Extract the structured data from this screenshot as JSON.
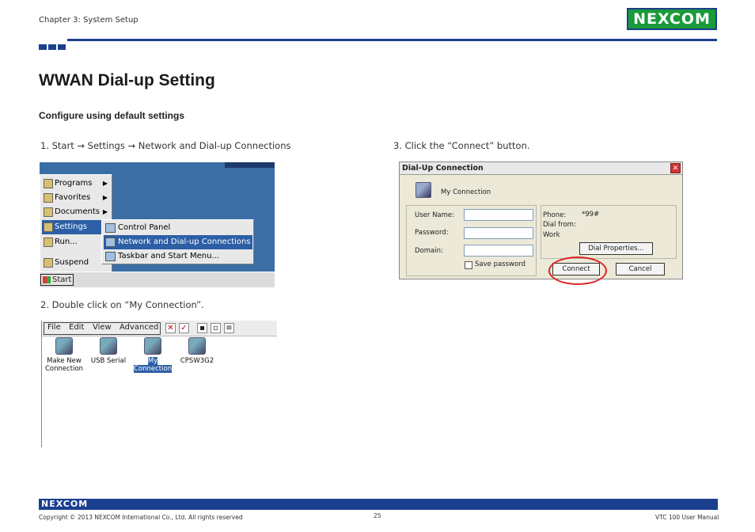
{
  "header": {
    "chapter": "Chapter 3: System Setup",
    "logo": "NEXCOM"
  },
  "title": "WWAN Dial-up Setting",
  "subtitle": "Configure using default settings",
  "steps": [
    "1. Start → Settings → Network and Dial-up Connections",
    "2. Double click on “My Connection”.",
    "3. Click the “Connect” button."
  ],
  "start_menu": {
    "items": [
      "Programs",
      "Favorites",
      "Documents",
      "Settings",
      "Run...",
      "Suspend"
    ],
    "submenu": [
      "Control Panel",
      "Network and Dial-up Connections",
      "Taskbar and Start Menu..."
    ],
    "start_label": "Start"
  },
  "explorer": {
    "menu": [
      "File",
      "Edit",
      "View",
      "Advanced"
    ],
    "icons": [
      "Make New Connection",
      "USB Serial",
      "My Connection",
      "CPSW3G2"
    ]
  },
  "dialog": {
    "title": "Dial-Up Connection",
    "connection_name": "My Connection",
    "labels": {
      "user_name": "User Name:",
      "password": "Password:",
      "domain": "Domain:",
      "save_password": "Save password"
    },
    "info": {
      "phone_label": "Phone:",
      "phone_value": "*99#",
      "dial_from_label": "Dial from:",
      "dial_from_value": "Work"
    },
    "buttons": {
      "dial_properties": "Dial Properties...",
      "connect": "Connect",
      "cancel": "Cancel"
    }
  },
  "footer": {
    "copyright": "Copyright © 2013 NEXCOM International Co., Ltd. All rights reserved",
    "page": "25",
    "manual": "VTC 100 User Manual"
  },
  "colors": {
    "brand_blue": "#1b3f8f",
    "brand_green": "#1a9a3a",
    "highlight": "#2c5fa5",
    "ring": "#dd2222"
  }
}
